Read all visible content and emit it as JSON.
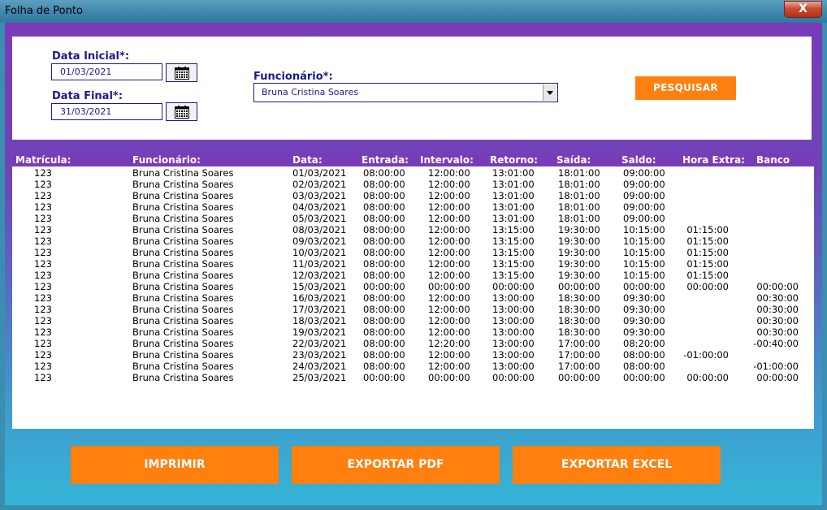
{
  "window": {
    "title": "Folha de Ponto",
    "close_glyph": "X"
  },
  "filters": {
    "data_inicial_label": "Data Inicial*:",
    "data_inicial_value": "01/03/2021",
    "data_final_label": "Data Final*:",
    "data_final_value": "31/03/2021",
    "funcionario_label": "Funcionário*:",
    "funcionario_value": "Bruna Cristina Soares",
    "search_button": "PESQUISAR",
    "calendar_icon": "calendar-icon"
  },
  "table": {
    "columns": [
      "Matrícula:",
      "Funcionário:",
      "Data:",
      "Entrada:",
      "Intervalo:",
      "Retorno:",
      "Saída:",
      "Saldo:",
      "Hora Extra:",
      "Banco"
    ],
    "rows": [
      [
        "123",
        "Bruna Cristina Soares",
        "01/03/2021",
        "08:00:00",
        "12:00:00",
        "13:01:00",
        "18:01:00",
        "09:00:00",
        "",
        ""
      ],
      [
        "123",
        "Bruna Cristina Soares",
        "02/03/2021",
        "08:00:00",
        "12:00:00",
        "13:01:00",
        "18:01:00",
        "09:00:00",
        "",
        ""
      ],
      [
        "123",
        "Bruna Cristina Soares",
        "03/03/2021",
        "08:00:00",
        "12:00:00",
        "13:01:00",
        "18:01:00",
        "09:00:00",
        "",
        ""
      ],
      [
        "123",
        "Bruna Cristina Soares",
        "04/03/2021",
        "08:00:00",
        "12:00:00",
        "13:01:00",
        "18:01:00",
        "09:00:00",
        "",
        ""
      ],
      [
        "123",
        "Bruna Cristina Soares",
        "05/03/2021",
        "08:00:00",
        "12:00:00",
        "13:01:00",
        "18:01:00",
        "09:00:00",
        "",
        ""
      ],
      [
        "123",
        "Bruna Cristina Soares",
        "08/03/2021",
        "08:00:00",
        "12:00:00",
        "13:15:00",
        "19:30:00",
        "10:15:00",
        "01:15:00",
        ""
      ],
      [
        "123",
        "Bruna Cristina Soares",
        "09/03/2021",
        "08:00:00",
        "12:00:00",
        "13:15:00",
        "19:30:00",
        "10:15:00",
        "01:15:00",
        ""
      ],
      [
        "123",
        "Bruna Cristina Soares",
        "10/03/2021",
        "08:00:00",
        "12:00:00",
        "13:15:00",
        "19:30:00",
        "10:15:00",
        "01:15:00",
        ""
      ],
      [
        "123",
        "Bruna Cristina Soares",
        "11/03/2021",
        "08:00:00",
        "12:00:00",
        "13:15:00",
        "19:30:00",
        "10:15:00",
        "01:15:00",
        ""
      ],
      [
        "123",
        "Bruna Cristina Soares",
        "12/03/2021",
        "08:00:00",
        "12:00:00",
        "13:15:00",
        "19:30:00",
        "10:15:00",
        "01:15:00",
        ""
      ],
      [
        "123",
        "Bruna Cristina Soares",
        "15/03/2021",
        "00:00:00",
        "00:00:00",
        "00:00:00",
        "00:00:00",
        "00:00:00",
        "00:00:00",
        "00:00:00"
      ],
      [
        "123",
        "Bruna Cristina Soares",
        "16/03/2021",
        "08:00:00",
        "12:00:00",
        "13:00:00",
        "18:30:00",
        "09:30:00",
        "",
        "00:30:00"
      ],
      [
        "123",
        "Bruna Cristina Soares",
        "17/03/2021",
        "08:00:00",
        "12:00:00",
        "13:00:00",
        "18:30:00",
        "09:30:00",
        "",
        "00:30:00"
      ],
      [
        "123",
        "Bruna Cristina Soares",
        "18/03/2021",
        "08:00:00",
        "12:00:00",
        "13:00:00",
        "18:30:00",
        "09:30:00",
        "",
        "00:30:00"
      ],
      [
        "123",
        "Bruna Cristina Soares",
        "19/03/2021",
        "08:00:00",
        "12:00:00",
        "13:00:00",
        "18:30:00",
        "09:30:00",
        "",
        "00:30:00"
      ],
      [
        "123",
        "Bruna Cristina Soares",
        "22/03/2021",
        "08:00:00",
        "12:20:00",
        "13:00:00",
        "17:00:00",
        "08:20:00",
        "",
        "-00:40:00"
      ],
      [
        "123",
        "Bruna Cristina Soares",
        "23/03/2021",
        "08:00:00",
        "12:00:00",
        "13:00:00",
        "17:00:00",
        "08:00:00",
        "-01:00:00",
        ""
      ],
      [
        "123",
        "Bruna Cristina Soares",
        "24/03/2021",
        "08:00:00",
        "12:00:00",
        "13:00:00",
        "17:00:00",
        "08:00:00",
        "",
        "-01:00:00"
      ],
      [
        "123",
        "Bruna Cristina Soares",
        "25/03/2021",
        "00:00:00",
        "00:00:00",
        "00:00:00",
        "00:00:00",
        "00:00:00",
        "00:00:00",
        "00:00:00"
      ]
    ]
  },
  "actions": {
    "imprimir": "IMPRIMIR",
    "exportar_pdf": "EXPORTAR PDF",
    "exportar_excel": "EXPORTAR EXCEL"
  },
  "colors": {
    "accent_orange": "#ff7f0f",
    "header_purple": "#7a3bb8",
    "label_navy": "#1c1a8c"
  }
}
